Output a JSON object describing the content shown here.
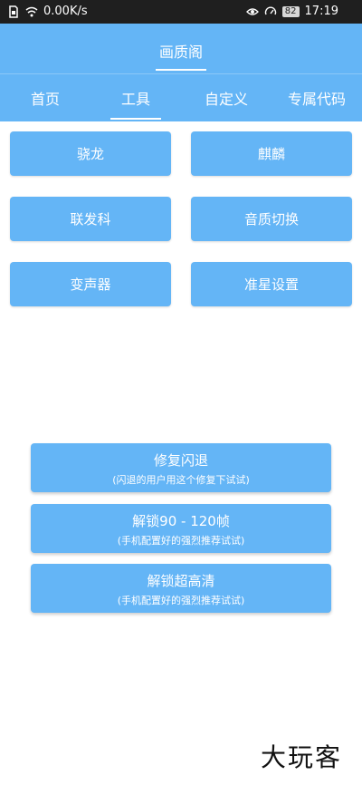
{
  "status_bar": {
    "network_speed": "0.00K/s",
    "battery": "82",
    "time": "17:19",
    "icons": [
      "sim-icon",
      "wifi-icon",
      "eye-icon",
      "speedometer-icon",
      "battery-icon"
    ]
  },
  "app": {
    "title": "画质阁"
  },
  "tabs": [
    {
      "label": "首页"
    },
    {
      "label": "工具"
    },
    {
      "label": "自定义"
    },
    {
      "label": "专属代码"
    }
  ],
  "active_tab": "工具",
  "tools": [
    {
      "label": "骁龙"
    },
    {
      "label": "麒麟"
    },
    {
      "label": "联发科"
    },
    {
      "label": "音质切换"
    },
    {
      "label": "变声器"
    },
    {
      "label": "准星设置"
    }
  ],
  "actions": [
    {
      "title": "修复闪退",
      "subtitle": "(闪退的用户用这个修复下试试)"
    },
    {
      "title": "解锁90 - 120帧",
      "subtitle": "(手机配置好的强烈推荐试试)"
    },
    {
      "title": "解锁超高清",
      "subtitle": "(手机配置好的强烈推荐试试)"
    }
  ],
  "watermark": "大玩客",
  "colors": {
    "primary": "#64b5f6",
    "status_bar": "#1f1f1f",
    "text_on_primary": "#ffffff"
  }
}
